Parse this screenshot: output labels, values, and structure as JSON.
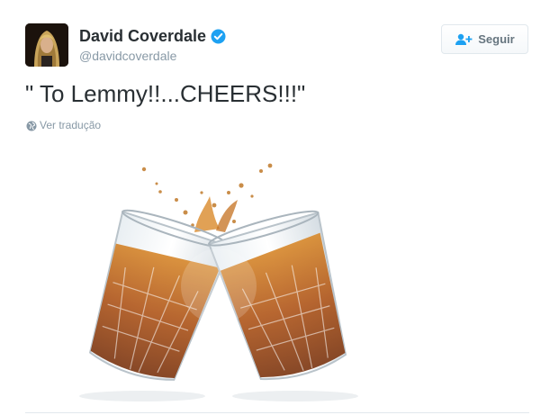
{
  "user": {
    "display_name": "David Coverdale",
    "handle": "@davidcoverdale",
    "verified": true
  },
  "follow_button": {
    "label": "Seguir",
    "icon": "add-user-icon"
  },
  "tweet": {
    "text": "\" To Lemmy!!...CHEERS!!!\"",
    "translate_label": "Ver tradução",
    "translate_icon": "globe-icon"
  },
  "media": {
    "description_icon": "whiskey-glasses-toast-image"
  },
  "colors": {
    "text": "#292f33",
    "muted": "#8899a6",
    "verified": "#1da1f2",
    "border": "#e1e8ed"
  }
}
